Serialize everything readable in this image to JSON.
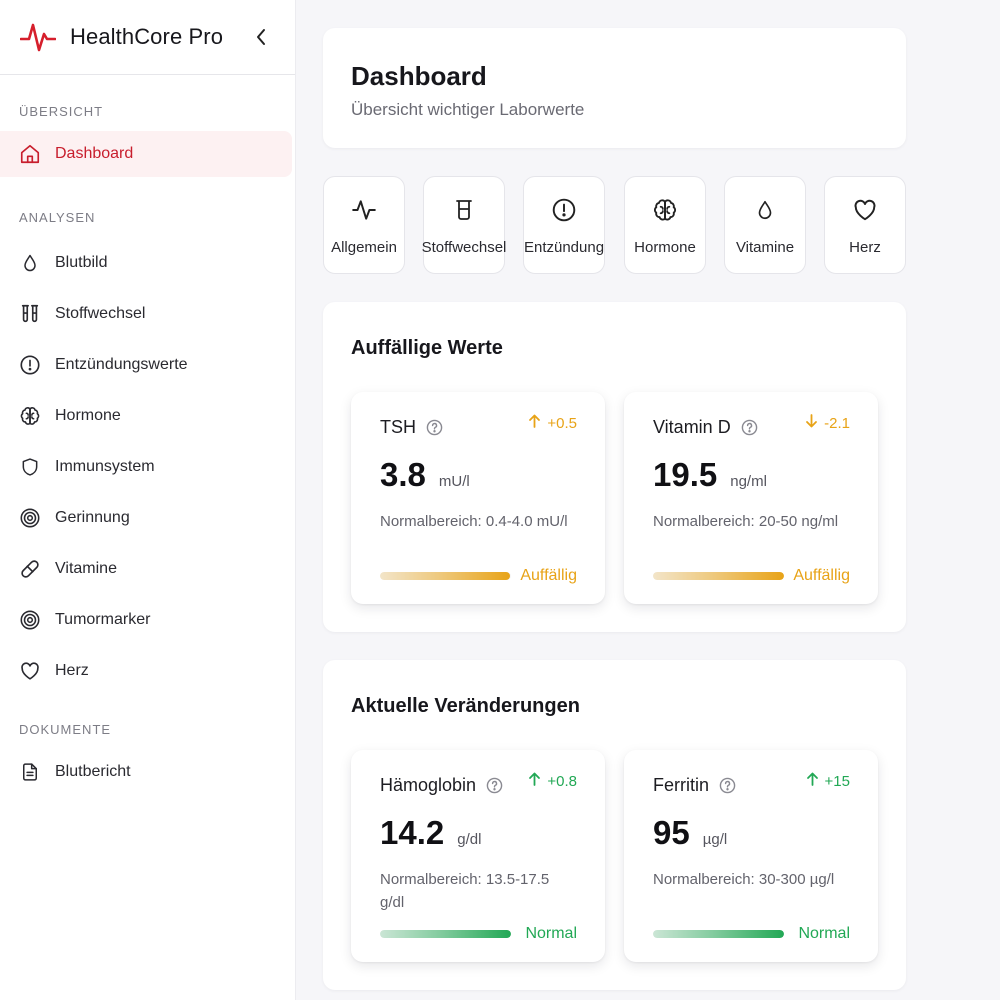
{
  "app": {
    "name": "HealthCore Pro",
    "accent": "#c81e2d"
  },
  "sidebar": {
    "sections": [
      {
        "label": "ÜBERSICHT"
      },
      {
        "label": "ANALYSEN"
      },
      {
        "label": "DOKUMENTE"
      }
    ],
    "items": [
      {
        "label": "Dashboard",
        "icon": "home-icon",
        "active": true
      },
      {
        "label": "Blutbild",
        "icon": "drop-icon"
      },
      {
        "label": "Stoffwechsel",
        "icon": "test-tubes-icon"
      },
      {
        "label": "Entzündungswerte",
        "icon": "alert-circle-icon"
      },
      {
        "label": "Hormone",
        "icon": "brain-icon"
      },
      {
        "label": "Immunsystem",
        "icon": "shield-icon"
      },
      {
        "label": "Gerinnung",
        "icon": "target-icon"
      },
      {
        "label": "Vitamine",
        "icon": "pill-icon"
      },
      {
        "label": "Tumormarker",
        "icon": "target-icon"
      },
      {
        "label": "Herz",
        "icon": "heart-icon"
      },
      {
        "label": "Blutbericht",
        "icon": "document-icon"
      }
    ]
  },
  "header": {
    "title": "Dashboard",
    "subtitle": "Übersicht wichtiger Laborwerte"
  },
  "categories": [
    {
      "label": "Allgemein",
      "icon": "activity-icon"
    },
    {
      "label": "Stoffwechsel",
      "icon": "beaker-icon"
    },
    {
      "label": "Entzündung",
      "icon": "alert-circle-icon"
    },
    {
      "label": "Hormone",
      "icon": "brain-icon"
    },
    {
      "label": "Vitamine",
      "icon": "drop-icon"
    },
    {
      "label": "Herz",
      "icon": "heart-icon"
    }
  ],
  "sections": [
    {
      "title": "Auffällige Werte",
      "metrics": [
        {
          "name": "TSH",
          "delta": "+0.5",
          "direction": "up",
          "value": "3.8",
          "unit": "mU/l",
          "range": "Normalbereich: 0.4-4.0 mU/l",
          "status": "Auffällig",
          "level": 0.99,
          "color": "#e8a317"
        },
        {
          "name": "Vitamin D",
          "delta": "-2.1",
          "direction": "down",
          "value": "19.5",
          "unit": "ng/ml",
          "range": "Normalbereich: 20-50 ng/ml",
          "status": "Auffällig",
          "level": 1.0,
          "color": "#e8a317"
        }
      ]
    },
    {
      "title": "Aktuelle Veränderungen",
      "metrics": [
        {
          "name": "Hämoglobin",
          "delta": "+0.8",
          "direction": "up",
          "value": "14.2",
          "unit": "g/dl",
          "range": "Normalbereich: 13.5-17.5 g/dl",
          "status": "Normal",
          "level": 1.0,
          "color": "#22a855"
        },
        {
          "name": "Ferritin",
          "delta": "+15",
          "direction": "up",
          "value": "95",
          "unit": "µg/l",
          "range": "Normalbereich: 30-300 µg/l",
          "status": "Normal",
          "level": 1.0,
          "color": "#22a855"
        }
      ]
    }
  ]
}
